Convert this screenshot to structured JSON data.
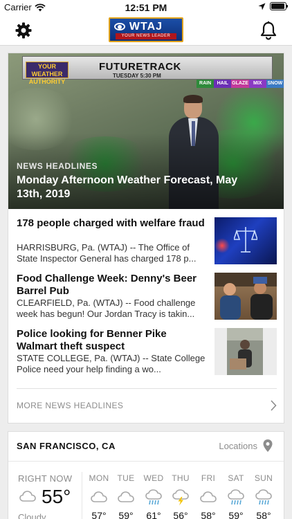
{
  "status_bar": {
    "carrier": "Carrier",
    "time": "12:51 PM"
  },
  "nav": {
    "logo_text": "WTAJ",
    "logo_tagline": "YOUR NEWS LEADER"
  },
  "hero": {
    "section_label": "NEWS HEADLINES",
    "title": "Monday Afternoon Weather Forecast, May 13th, 2019",
    "banner_title": "FUTURETRACK",
    "banner_sub": "TUESDAY       5:30 PM",
    "brand": "YOUR WEATHER AUTHORITY",
    "legend": [
      "RAIN",
      "HAIL",
      "GLAZE",
      "MIX",
      "SNOW"
    ]
  },
  "stories": [
    {
      "title": "178 people charged with welfare fraud",
      "snippet": "HARRISBURG, Pa. (WTAJ) -- The Office of State Inspector General has charged 178 p..."
    },
    {
      "title": "Food Challenge Week: Denny's Beer Barrel Pub",
      "snippet": "CLEARFIELD, Pa. (WTAJ) -- Food challenge week has begun! Our Jordan Tracy is takin..."
    },
    {
      "title": "Police looking for Benner Pike Walmart theft suspect",
      "snippet": "STATE COLLEGE, Pa. (WTAJ) -- State College Police need your help finding a wo..."
    }
  ],
  "more_news_label": "MORE NEWS HEADLINES",
  "weather": {
    "city": "SAN FRANCISCO, CA",
    "locations_label": "Locations",
    "now_label": "RIGHT NOW",
    "now_temp": "55°",
    "now_condition": "Cloudy",
    "days": [
      {
        "name": "MON",
        "icon": "cloud-icon",
        "temp": "57°"
      },
      {
        "name": "TUE",
        "icon": "cloud-icon",
        "temp": "59°"
      },
      {
        "name": "WED",
        "icon": "rain-icon",
        "temp": "61°"
      },
      {
        "name": "THU",
        "icon": "thunderstorm-icon",
        "temp": "56°"
      },
      {
        "name": "FRI",
        "icon": "cloud-icon",
        "temp": "58°"
      },
      {
        "name": "SAT",
        "icon": "rain-icon",
        "temp": "59°"
      },
      {
        "name": "SUN",
        "icon": "rain-icon",
        "temp": "58°"
      }
    ]
  },
  "colors": {
    "accent_gold": "#e2a41c",
    "logo_blue": "#0e2f77",
    "icon_blue": "#5aa9d6",
    "lightning_yellow": "#f2c200",
    "muted_text": "#8c8c8c"
  }
}
